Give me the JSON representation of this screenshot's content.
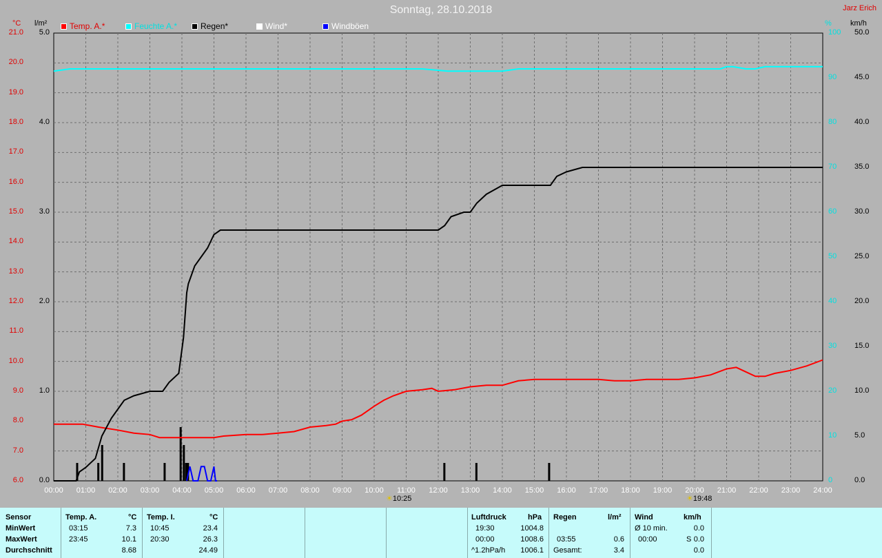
{
  "header": {
    "title": "Sonntag, 28.10.2018",
    "author": "Jarz Erich"
  },
  "units": {
    "temp": "°C",
    "rain": "l/m²",
    "humidity": "%",
    "wind": "km/h"
  },
  "legend": [
    {
      "label": "Temp. A.*",
      "color": "#ff0000"
    },
    {
      "label": "Feuchte A.*",
      "color": "#00ffff"
    },
    {
      "label": "Regen*",
      "color": "#000000"
    },
    {
      "label": "Wind*",
      "color": "#ffffff"
    },
    {
      "label": "Windböen",
      "color": "#0000ff"
    }
  ],
  "markers": [
    {
      "label": "10:25"
    },
    {
      "label": "19:48"
    }
  ],
  "chart_data": {
    "type": "line",
    "xlabel": "",
    "x_range": [
      0,
      24
    ],
    "x_ticks": [
      "00:00",
      "01:00",
      "02:00",
      "03:00",
      "04:00",
      "05:00",
      "06:00",
      "07:00",
      "08:00",
      "09:00",
      "10:00",
      "11:00",
      "12:00",
      "13:00",
      "14:00",
      "15:00",
      "16:00",
      "17:00",
      "18:00",
      "19:00",
      "20:00",
      "21:00",
      "22:00",
      "23:00",
      "24:00"
    ],
    "axes": {
      "temp": {
        "range": [
          6,
          21
        ],
        "ticks": [
          "6.0",
          "7.0",
          "8.0",
          "9.0",
          "10.0",
          "11.0",
          "12.0",
          "13.0",
          "14.0",
          "15.0",
          "16.0",
          "17.0",
          "18.0",
          "19.0",
          "20.0",
          "21.0"
        ]
      },
      "rain": {
        "range": [
          0,
          5
        ],
        "ticks": [
          "0.0",
          "1.0",
          "2.0",
          "3.0",
          "4.0",
          "5.0"
        ]
      },
      "humidity": {
        "range": [
          0,
          100
        ],
        "ticks": [
          "0",
          "10",
          "20",
          "30",
          "40",
          "50",
          "60",
          "70",
          "80",
          "90",
          "100"
        ]
      },
      "wind": {
        "range": [
          0,
          50
        ],
        "ticks": [
          "0.0",
          "5.0",
          "10.0",
          "15.0",
          "20.0",
          "25.0",
          "30.0",
          "35.0",
          "40.0",
          "45.0",
          "50.0"
        ]
      }
    },
    "grid": true,
    "series": [
      {
        "name": "Temp. A.*",
        "axis": "temp",
        "color": "#ff0000",
        "x": [
          0,
          0.9,
          1.4,
          2.0,
          2.5,
          3.0,
          3.3,
          4.0,
          5.0,
          5.3,
          6.0,
          6.5,
          7.0,
          7.5,
          8.0,
          8.5,
          8.8,
          9.0,
          9.3,
          9.6,
          10.0,
          10.3,
          10.6,
          11.0,
          11.5,
          11.8,
          12.0,
          12.5,
          13.0,
          13.5,
          14.0,
          14.5,
          15.0,
          15.5,
          16.0,
          16.5,
          17.0,
          17.5,
          18.0,
          18.5,
          19.0,
          19.5,
          20.0,
          20.5,
          21.0,
          21.3,
          21.6,
          21.9,
          22.2,
          22.5,
          23.0,
          23.5,
          24.0
        ],
        "y": [
          7.9,
          7.9,
          7.8,
          7.7,
          7.6,
          7.55,
          7.45,
          7.45,
          7.45,
          7.5,
          7.55,
          7.55,
          7.6,
          7.65,
          7.8,
          7.85,
          7.9,
          8.0,
          8.05,
          8.2,
          8.5,
          8.7,
          8.85,
          9.0,
          9.05,
          9.1,
          9.0,
          9.05,
          9.15,
          9.2,
          9.2,
          9.35,
          9.4,
          9.4,
          9.4,
          9.4,
          9.4,
          9.35,
          9.35,
          9.4,
          9.4,
          9.4,
          9.45,
          9.55,
          9.75,
          9.8,
          9.65,
          9.5,
          9.5,
          9.6,
          9.7,
          9.85,
          10.05
        ]
      },
      {
        "name": "Feuchte A.*",
        "axis": "humidity",
        "color": "#00ffff",
        "x": [
          0,
          0.5,
          1.0,
          2.0,
          4.0,
          6.0,
          8.0,
          10.0,
          11.5,
          12.3,
          13.0,
          14.0,
          14.5,
          15.0,
          16.0,
          18.0,
          20.0,
          20.8,
          21.0,
          21.2,
          21.6,
          21.9,
          22.2,
          23.0,
          24.0
        ],
        "y": [
          91.5,
          92,
          92,
          92,
          92,
          92,
          92,
          92,
          92,
          91.5,
          91.5,
          91.5,
          92,
          92,
          92,
          92,
          92,
          92,
          92.5,
          92.5,
          92,
          92,
          92.5,
          92.5,
          92.5
        ]
      },
      {
        "name": "Regen*",
        "axis": "rain",
        "color": "#000000",
        "x": [
          0,
          0.7,
          0.8,
          1.0,
          1.3,
          1.5,
          1.8,
          2.0,
          2.2,
          2.5,
          3.0,
          3.4,
          3.6,
          3.9,
          4.05,
          4.15,
          4.2,
          4.4,
          4.6,
          4.8,
          5.0,
          5.2,
          5.5,
          5.8,
          6.0,
          8.0,
          10.0,
          11.5,
          12.0,
          12.2,
          12.4,
          12.8,
          13.0,
          13.2,
          13.5,
          14.0,
          15.0,
          15.5,
          15.7,
          16.0,
          16.5,
          18.0,
          20.0,
          22.0,
          24.0
        ],
        "y": [
          0,
          0,
          0.1,
          0.15,
          0.25,
          0.5,
          0.7,
          0.8,
          0.9,
          0.95,
          1.0,
          1.0,
          1.1,
          1.2,
          1.6,
          2.1,
          2.2,
          2.4,
          2.5,
          2.6,
          2.75,
          2.8,
          2.8,
          2.8,
          2.8,
          2.8,
          2.8,
          2.8,
          2.8,
          2.85,
          2.95,
          3.0,
          3.0,
          3.1,
          3.2,
          3.3,
          3.3,
          3.3,
          3.4,
          3.45,
          3.5,
          3.5,
          3.5,
          3.5,
          3.5
        ]
      },
      {
        "name": "Windböen",
        "axis": "wind",
        "color": "#0000ff",
        "x": [
          4.15,
          4.25,
          4.35,
          4.5,
          4.6,
          4.7,
          4.8,
          4.9,
          5.0,
          5.05,
          5.1
        ],
        "y": [
          0,
          1.6,
          0,
          0,
          1.6,
          1.6,
          0,
          0,
          1.6,
          0,
          0
        ]
      },
      {
        "name": "Regenrate",
        "axis": "rain",
        "color": "#000000",
        "type": "bar",
        "x": [
          0.72,
          1.38,
          1.5,
          2.18,
          3.45,
          3.95,
          4.05,
          4.12,
          4.18,
          12.18,
          13.18,
          15.45
        ],
        "y": [
          0.2,
          0.2,
          0.4,
          0.2,
          0.2,
          0.6,
          0.4,
          0.2,
          0.2,
          0.2,
          0.2,
          0.2
        ]
      }
    ]
  },
  "stats": {
    "headers": {
      "sensor": "Sensor",
      "temp_a": "Temp. A.",
      "temp_a_unit": "°C",
      "temp_i": "Temp. I.",
      "temp_i_unit": "°C",
      "pressure": "Luftdruck",
      "pressure_unit": "hPa",
      "rain": "Regen",
      "rain_unit": "l/m²",
      "wind": "Wind",
      "wind_unit": "km/h"
    },
    "rows": [
      {
        "label": "MinWert",
        "ta_time": "03:15",
        "ta_val": "7.3",
        "ti_time": "10:45",
        "ti_val": "23.4",
        "p_time": "19:30",
        "p_val": "1004.8",
        "r_time": "",
        "r_val": "",
        "w_time": "Ø 10 min.",
        "w_val": "0.0"
      },
      {
        "label": "MaxWert",
        "ta_time": "23:45",
        "ta_val": "10.1",
        "ti_time": "20:30",
        "ti_val": "26.3",
        "p_time": "00:00",
        "p_val": "1008.6",
        "r_time": "03:55",
        "r_val": "0.6",
        "w_time": "00:00",
        "w_dir": "S",
        "w_val": "0.0"
      },
      {
        "label": "Durchschnitt",
        "ta_time": "",
        "ta_val": "8.68",
        "ti_time": "",
        "ti_val": "24.49",
        "p_time": "^1.2hPa/h",
        "p_val": "1006.1",
        "r_time": "Gesamt:",
        "r_val": "3.4",
        "w_time": "",
        "w_val": "0.0"
      }
    ]
  }
}
